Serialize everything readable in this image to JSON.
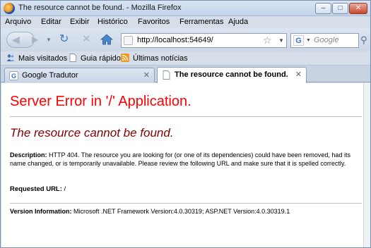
{
  "window": {
    "title": "The resource cannot be found. - Mozilla Firefox",
    "buttons": {
      "minimize": "–",
      "maximize": "□",
      "close": "✕"
    }
  },
  "menu": [
    "Arquivo",
    "Editar",
    "Exibir",
    "Histórico",
    "Favoritos",
    "Ferramentas",
    "Ajuda"
  ],
  "navigation": {
    "url": "http://localhost:54649/",
    "search_placeholder": "Google",
    "search_engine_icon": "G"
  },
  "bookmarks": [
    "Mais visitados",
    "Guia rápido",
    "Últimas notícias"
  ],
  "tabs": [
    {
      "label": "Google Tradutor",
      "active": false
    },
    {
      "label": "The resource cannot be found.",
      "active": true
    }
  ],
  "page": {
    "heading": "Server Error in '/' Application.",
    "subheading": "The resource cannot be found.",
    "description_label": "Description:",
    "description_text": "HTTP 404. The resource you are looking for (or one of its dependencies) could have been removed, had its name changed, or is temporarily unavailable.  Please review the following URL and make sure that it is spelled correctly.",
    "requested_url_label": "Requested URL:",
    "requested_url": "/",
    "version_label": "Version Information:",
    "version_text": "Microsoft .NET Framework Version:4.0.30319; ASP.NET Version:4.0.30319.1"
  },
  "colors": {
    "heading": "#ff0000",
    "subheading": "#800000"
  }
}
